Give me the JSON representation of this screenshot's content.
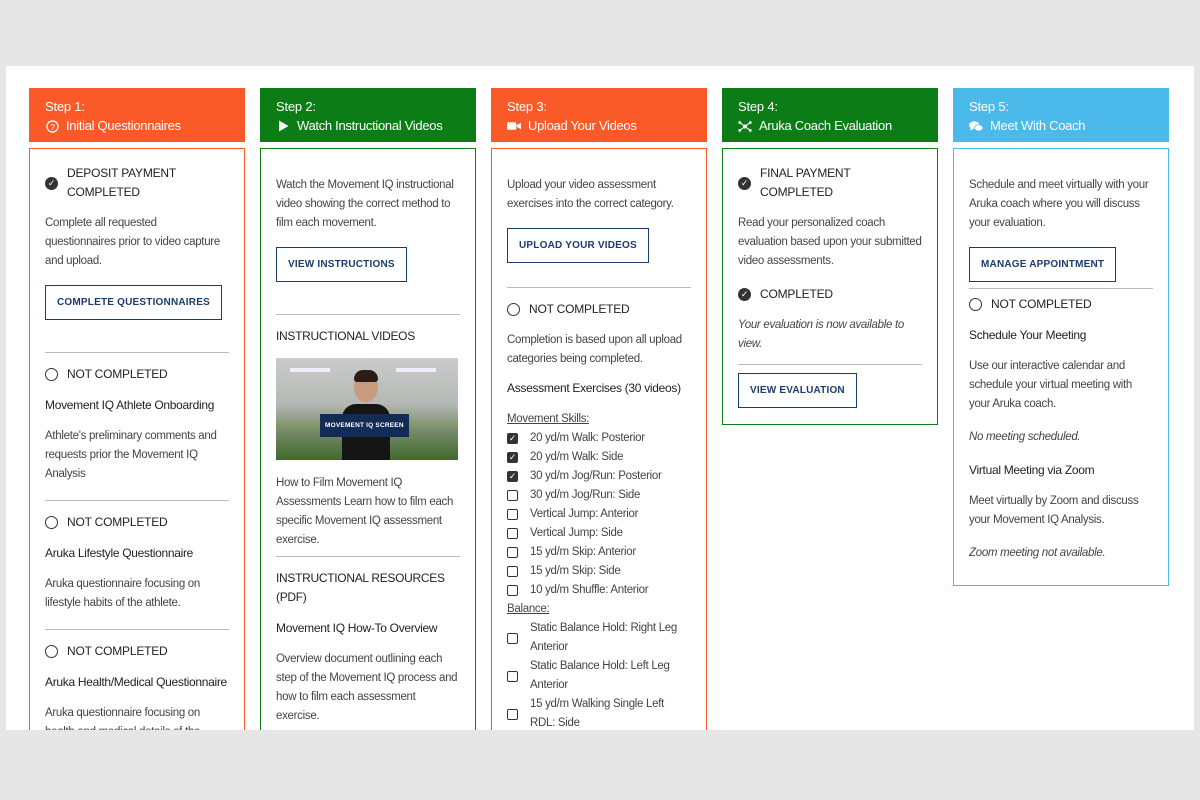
{
  "steps": [
    {
      "step": "Step 1:",
      "title": "Initial Questionnaires",
      "icon": "question-circle-icon",
      "color": "#fa5a28",
      "status": "DEPOSIT PAYMENT COMPLETED",
      "text": "Complete all requested questionnaires prior to video capture and upload.",
      "button": "COMPLETE QUESTIONNAIRES",
      "items": [
        {
          "status": "NOT COMPLETED",
          "title": "Movement IQ Athlete Onboarding",
          "desc": "Athlete's preliminary comments and requests prior the Movement IQ Analysis"
        },
        {
          "status": "NOT COMPLETED",
          "title": "Aruka Lifestyle Questionnaire",
          "desc": "Aruka questionnaire focusing on lifestyle habits of the athlete."
        },
        {
          "status": "NOT COMPLETED",
          "title": "Aruka Health/Medical Questionnaire",
          "desc": "Aruka questionnaire focusing on health and medical details of the athlete."
        }
      ]
    },
    {
      "step": "Step 2:",
      "title": "Watch Instructional Videos",
      "icon": "play-icon",
      "color": "#0c7d16",
      "text": "Watch the Movement IQ instructional video showing the correct method to film each movement.",
      "button": "VIEW INSTRUCTIONS",
      "videos_heading": "INSTRUCTIONAL VIDEOS",
      "video_caption_overlay": "MOVEMENT IQ SCREEN",
      "video_caption": "How to Film Movement IQ Assessments Learn how to film each specific Movement IQ assessment exercise.",
      "resources_heading": "INSTRUCTIONAL RESOURCES (PDF)",
      "resource_title": "Movement IQ How-To Overview",
      "resource_desc": "Overview document outlining each step of the Movement IQ process and how to film each assessment exercise."
    },
    {
      "step": "Step 3:",
      "title": "Upload Your Videos",
      "icon": "video-camera-icon",
      "color": "#fa5a28",
      "text": "Upload your video assessment exercises into the correct category.",
      "button": "UPLOAD YOUR VIDEOS",
      "status": "NOT COMPLETED",
      "note": "Completion is based upon all upload categories being completed.",
      "exercises_title": "Assessment Exercises (30 videos)",
      "group1": "Movement Skills:",
      "skills": [
        {
          "label": "20 yd/m Walk: Posterior",
          "checked": true
        },
        {
          "label": "20 yd/m Walk: Side",
          "checked": true
        },
        {
          "label": "30 yd/m Jog/Run: Posterior",
          "checked": true
        },
        {
          "label": "30 yd/m Jog/Run: Side",
          "checked": false
        },
        {
          "label": "Vertical Jump: Anterior",
          "checked": false
        },
        {
          "label": "Vertical Jump: Side",
          "checked": false
        },
        {
          "label": "15 yd/m Skip: Anterior",
          "checked": false
        },
        {
          "label": "15 yd/m Skip: Side",
          "checked": false
        },
        {
          "label": "10 yd/m Shuffle: Anterior",
          "checked": false
        }
      ],
      "group2": "Balance:",
      "balance": [
        {
          "label": "Static Balance Hold: Right Leg Anterior",
          "checked": false
        },
        {
          "label": "Static Balance Hold: Left Leg Anterior",
          "checked": false
        },
        {
          "label": "15 yd/m Walking Single Left RDL: Side",
          "checked": false
        }
      ]
    },
    {
      "step": "Step 4:",
      "title": "Aruka Coach Evaluation",
      "icon": "network-nodes-icon",
      "color": "#0c7d16",
      "status": "FINAL PAYMENT COMPLETED",
      "text": "Read your personalized coach evaluation based upon your submitted video assessments.",
      "status2": "COMPLETED",
      "note": "Your evaluation is now available to view.",
      "button": "VIEW EVALUATION"
    },
    {
      "step": "Step 5:",
      "title": "Meet With Coach",
      "icon": "chat-bubbles-icon",
      "color": "#4bb9ea",
      "text": "Schedule and meet virtually with your Aruka coach where you will discuss your evaluation.",
      "button": "MANAGE APPOINTMENT",
      "status": "NOT COMPLETED",
      "meeting_title": "Schedule Your Meeting",
      "meeting_desc": "Use our interactive calendar and schedule your virtual meeting with your Aruka coach.",
      "meeting_note": "No meeting scheduled.",
      "zoom_title": "Virtual Meeting via Zoom",
      "zoom_desc": "Meet virtually by Zoom and discuss your Movement IQ Analysis.",
      "zoom_note": "Zoom meeting not available."
    }
  ]
}
